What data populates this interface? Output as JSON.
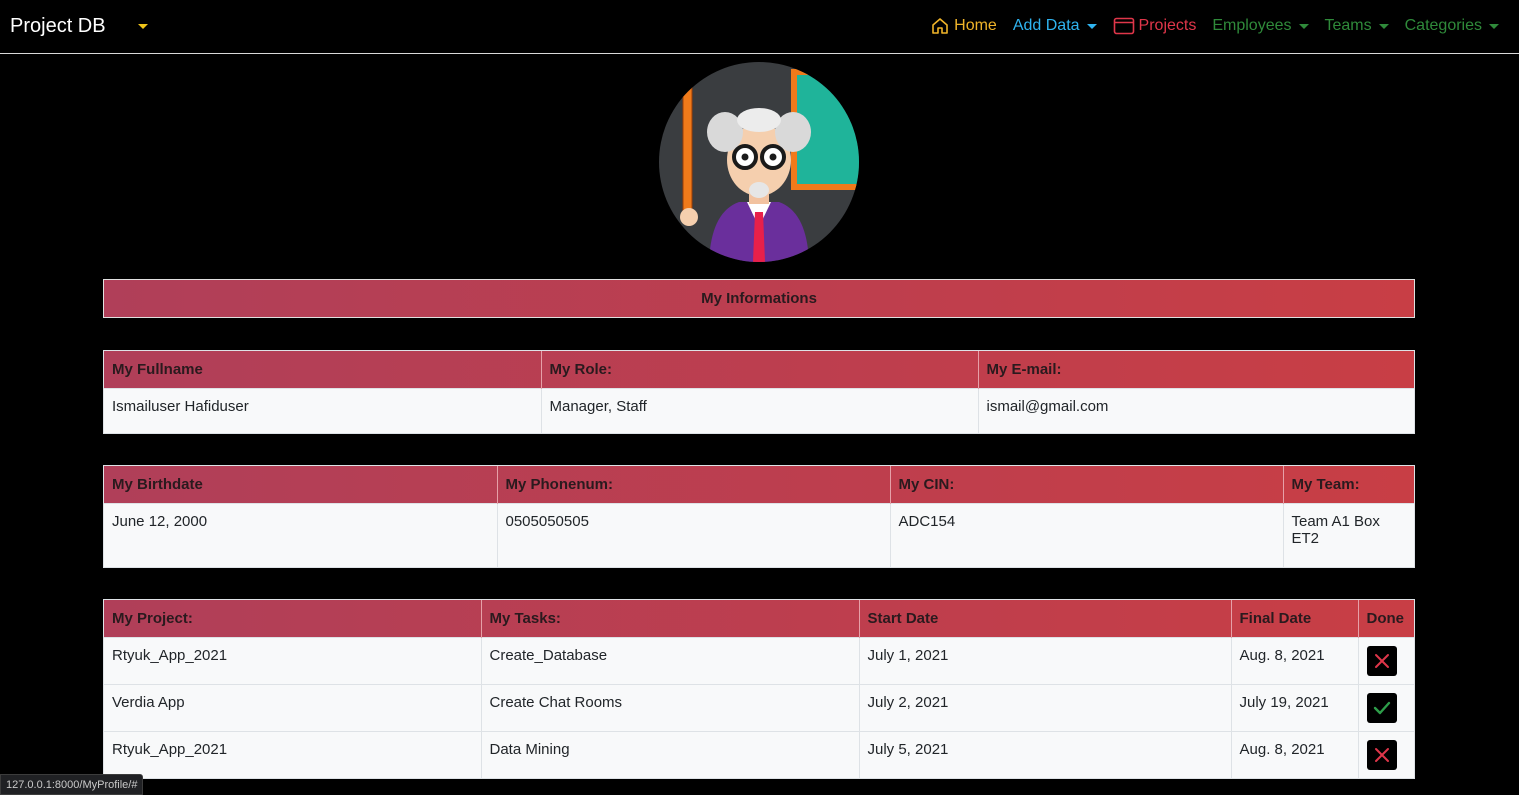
{
  "navbar": {
    "brand": "Project DB",
    "items": [
      {
        "label": "Home",
        "color": "#f0b429"
      },
      {
        "label": "Add Data",
        "color": "#2fb4f0"
      },
      {
        "label": "Projects",
        "color": "#e0364a"
      },
      {
        "label": "Employees",
        "color": "#2f8a3a"
      },
      {
        "label": "Teams",
        "color": "#2f8a3a"
      },
      {
        "label": "Categories",
        "color": "#2f8a3a"
      }
    ]
  },
  "profile": {
    "section_title": "My Informations",
    "table1": {
      "headers": [
        "My Fullname",
        "My Role:",
        "My E-mail:"
      ],
      "row": [
        "Ismailuser Hafiduser",
        "Manager, Staff",
        "ismail@gmail.com"
      ]
    },
    "table2": {
      "headers": [
        "My Birthdate",
        "My Phonenum:",
        "My CIN:",
        "My Team:"
      ],
      "row": [
        "June 12, 2000",
        "0505050505",
        "ADC154",
        "Team A1 Box ET2"
      ]
    },
    "tasks": {
      "headers": [
        "My Project:",
        "My Tasks:",
        "Start Date",
        "Final Date",
        "Done"
      ],
      "rows": [
        {
          "project": "Rtyuk_App_2021",
          "task": "Create_Database",
          "start": "July 1, 2021",
          "final": "Aug. 8, 2021",
          "done": false
        },
        {
          "project": "Verdia App",
          "task": "Create Chat Rooms",
          "start": "July 2, 2021",
          "final": "July 19, 2021",
          "done": true
        },
        {
          "project": "Rtyuk_App_2021",
          "task": "Data Mining",
          "start": "July 5, 2021",
          "final": "Aug. 8, 2021",
          "done": false
        }
      ]
    }
  },
  "status_url": "127.0.0.1:8000/MyProfile/#",
  "colors": {
    "header_gradient_start": "#b03f59",
    "header_gradient_end": "#c83e45",
    "done_true": "#2e9e4a",
    "done_false": "#e0364a"
  }
}
